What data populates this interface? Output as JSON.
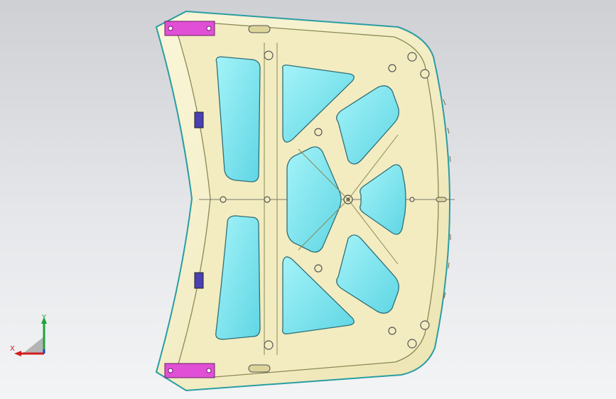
{
  "view": {
    "background_top": "#cfd0d4",
    "background_bottom": "#f3f4f6"
  },
  "model": {
    "skin_color": "#f4efc6",
    "skin_stroke": "#8a8a55",
    "window_color": "#7fe3ee",
    "window_stroke": "#2f6f78",
    "hinge_color": "#e04fd6",
    "latch_color": "#4b3fb4",
    "edge_color": "#2a9da3"
  },
  "triad": {
    "x_label": "X",
    "y_label": "Y",
    "x_color": "#d21e1e",
    "y_color": "#1fa33a",
    "z_color": "#1f3fd2"
  }
}
